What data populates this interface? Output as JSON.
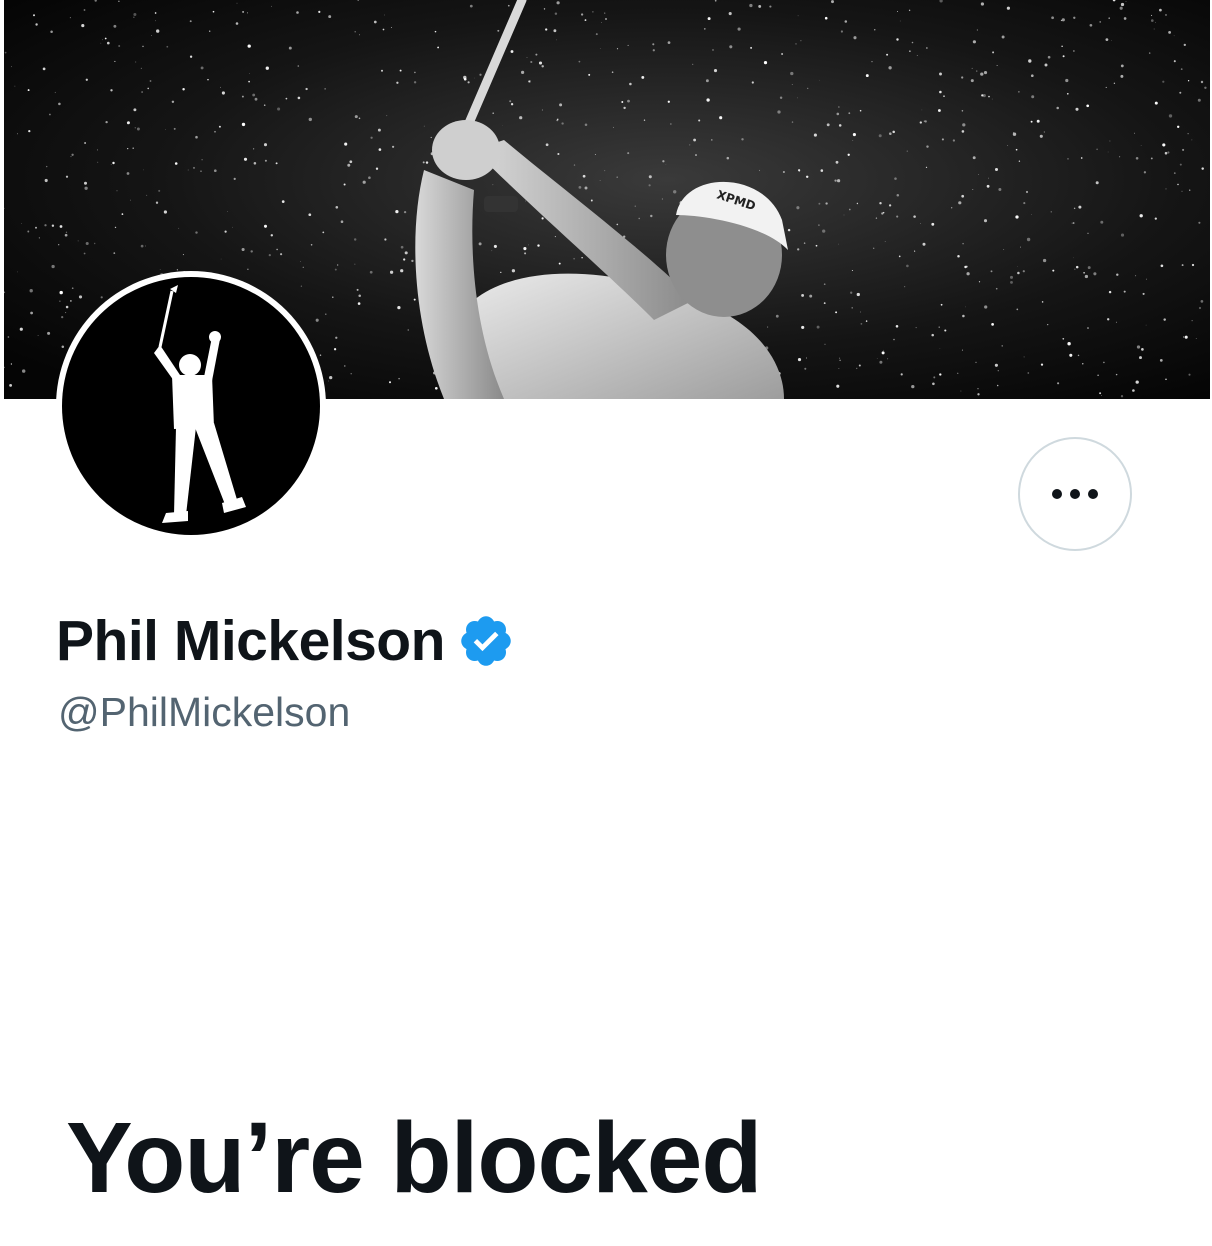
{
  "profile": {
    "display_name": "Phil Mickelson",
    "handle": "@PhilMickelson",
    "verified": true,
    "banner_image": "black-and-white photo of golfer swinging club amid water spray",
    "avatar_image": "white silhouette of golfer celebrating with arms raised on black circle"
  },
  "actions": {
    "more_button_icon": "ellipsis-icon"
  },
  "status": {
    "blocked_heading": "You’re blocked"
  },
  "colors": {
    "text_primary": "#0f1419",
    "text_secondary": "#536471",
    "verified_blue": "#1d9bf0",
    "button_border": "#cfd9de",
    "banner_bg": "#0b0b0b"
  }
}
